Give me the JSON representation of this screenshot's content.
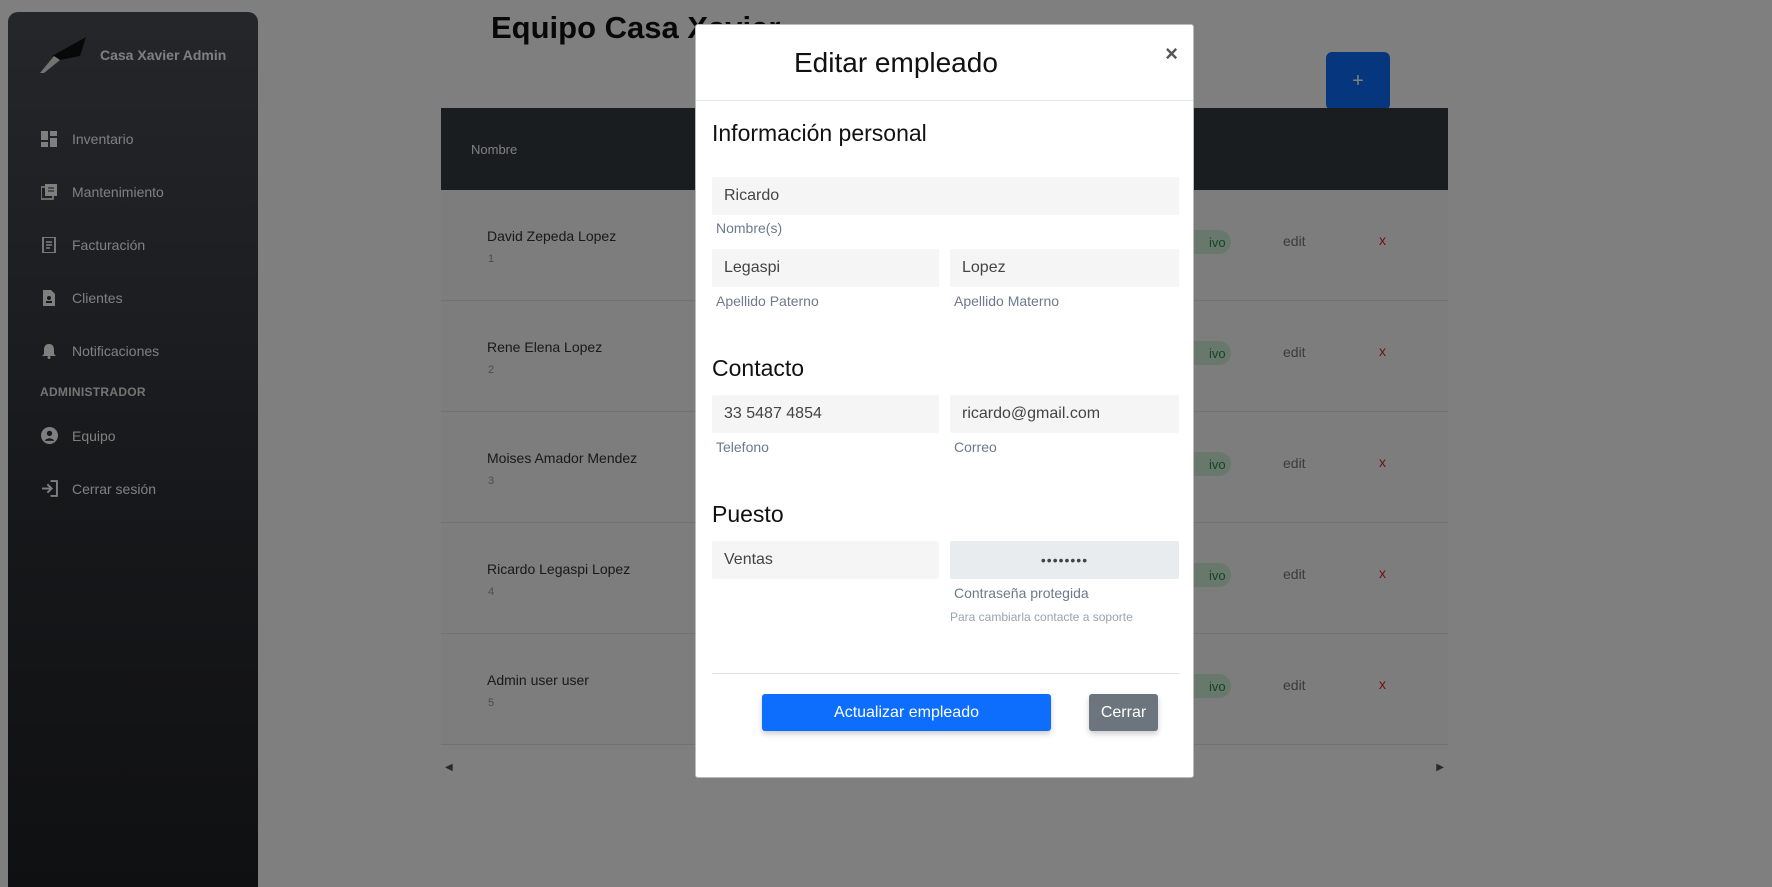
{
  "sidebar": {
    "brand": "Casa Xavier Admin",
    "items": [
      {
        "label": "Inventario",
        "icon": "dashboard-icon"
      },
      {
        "label": "Mantenimiento",
        "icon": "stack-icon"
      },
      {
        "label": "Facturación",
        "icon": "receipt-icon"
      },
      {
        "label": "Clientes",
        "icon": "contact-file-icon"
      },
      {
        "label": "Notificaciones",
        "icon": "bell-icon"
      }
    ],
    "section": "ADMINISTRADOR",
    "admin_items": [
      {
        "label": "Equipo",
        "icon": "user-circle-icon"
      },
      {
        "label": "Cerrar sesión",
        "icon": "logout-icon"
      }
    ]
  },
  "page": {
    "title": "Equipo Casa Xavier",
    "add_label": "+",
    "table_header": "Nombre",
    "rows": [
      {
        "name": "David Zepeda Lopez",
        "id": "1",
        "status": "ivo",
        "edit": "edit",
        "delete": "x"
      },
      {
        "name": "Rene Elena Lopez",
        "id": "2",
        "status": "ivo",
        "edit": "edit",
        "delete": "x"
      },
      {
        "name": "Moises Amador Mendez",
        "id": "3",
        "status": "ivo",
        "edit": "edit",
        "delete": "x"
      },
      {
        "name": "Ricardo Legaspi Lopez",
        "id": "4",
        "status": "ivo",
        "edit": "edit",
        "delete": "x"
      },
      {
        "name": "Admin user user",
        "id": "5",
        "status": "ivo",
        "edit": "edit",
        "delete": "x"
      }
    ]
  },
  "modal": {
    "title": "Editar empleado",
    "close": "×",
    "personal_title": "Información personal",
    "nombre": {
      "value": "Ricardo",
      "label": "Nombre(s)"
    },
    "apellido_paterno": {
      "value": "Legaspi",
      "label": "Apellido Paterno"
    },
    "apellido_materno": {
      "value": "Lopez",
      "label": "Apellido Materno"
    },
    "contact_title": "Contacto",
    "telefono": {
      "value": "33 5487 4854",
      "label": "Telefono"
    },
    "correo": {
      "value": "ricardo@gmail.com",
      "label": "Correo"
    },
    "puesto_title": "Puesto",
    "puesto": {
      "value": "Ventas"
    },
    "password": {
      "value": "••••••••",
      "label": "Contraseña protegida",
      "hint": "Para cambiarla contacte a soporte"
    },
    "submit": "Actualizar empleado",
    "cancel": "Cerrar"
  },
  "colors": {
    "primary": "#0d6efd",
    "secondary": "#6c757d",
    "danger": "#e02020",
    "table_header": "#343a40"
  }
}
